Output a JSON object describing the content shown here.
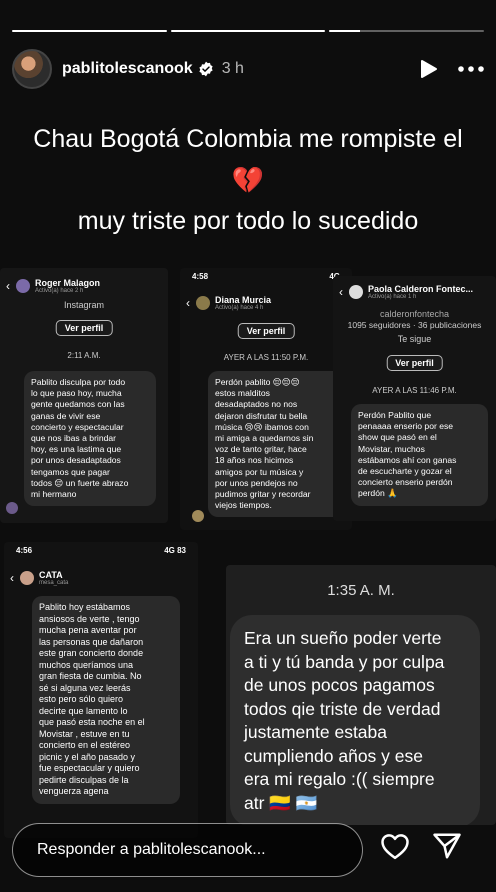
{
  "header": {
    "username": "pablitolescanook",
    "time": "3 h",
    "icons": [
      "verified-badge-icon",
      "play-icon",
      "more-icon"
    ]
  },
  "progress": [
    1,
    1,
    0.2
  ],
  "caption": {
    "line1": "Chau Bogotá Colombia me rompiste el",
    "heart": "💔",
    "line2": "muy triste por todo lo sucedido"
  },
  "chats": {
    "roger": {
      "name": "Roger Malagon",
      "sub": "Activo(a) hace 2 h",
      "platform": "Instagram",
      "button": "Ver perfil",
      "time": "2:11 A.M.",
      "message": "Pablito disculpa por todo\nlo que paso hoy, mucha\ngente quedamos con las\nganas de vivir ese\nconcierto y espectacular\nque nos ibas a brindar\nhoy, es una lastima que\npor unos desadaptados\ntengamos que pagar\ntodos 😔 un fuerte abrazo\nmi hermano"
    },
    "diana": {
      "status_time": "4:58",
      "status_right": "4G",
      "name": "Diana Murcia",
      "sub": "Activo(a) hace 4 h",
      "button": "Ver perfil",
      "time": "AYER A LAS 11:50 P.M.",
      "message": "Perdón pablito 😔😔😔\nestos malditos\ndesadaptados no nos\ndejaron disfrutar tu bella\nmúsica 😢😢 ibamos con\nmi amiga a quedarnos sin\nvoz de tanto gritar, hace\n18 años nos hicimos\namigos por tu música y\npor unos pendejos no\npudimos gritar y recordar\nviejos tiempos."
    },
    "paola": {
      "name": "Paola Calderon Fontec...",
      "sub": "Activo(a) hace 1 h",
      "handle": "calderonfontecha",
      "stats": "1095 seguidores · 36 publicaciones",
      "follows": "Te sigue",
      "button": "Ver perfil",
      "time": "AYER A LAS 11:46 P.M.",
      "message": "Perdón Pablito que\npenaaaa enserio por ese\nshow que pasó en el\nMovistar, muchos\nestábamos ahí con ganas\nde escucharte y gozar el\nconcierto enserio perdón\nperdón 🙏"
    },
    "cata": {
      "status_time": "4:56",
      "status_right": "4G 83",
      "name": "CATA",
      "sub": "mesa_cata",
      "message": "Pablito hoy estábamos\nansiosos de verte , tengo\nmucha pena aventar por\nlas personas que dañaron\neste gran concierto donde\nmuchos queríamos una\ngran fiesta de cumbia. No\nsé si alguna vez leerás\nesto pero sólo quiero\ndecirte que lamento lo\nque pasó esta noche en el\nMovistar , estuve en tu\nconcierto en el estéreo\npicnic y el año pasado y\nfue espectacular y quiero\npedirte disculpas de la\nvenguerza agena"
    },
    "last": {
      "time": "1:35 A. M.",
      "message": "Era un sueño poder verte\na ti y tú banda y por culpa\nde unos pocos pagamos\ntodos qie triste de verdad\njustamente estaba\ncumpliendo años y ese\nera mi regalo :(( siempre\natr 🇨🇴 🇦🇷"
    }
  },
  "reply": {
    "placeholder": "Responder a pablitolescanook...",
    "icons": [
      "heart-icon",
      "send-icon"
    ]
  }
}
